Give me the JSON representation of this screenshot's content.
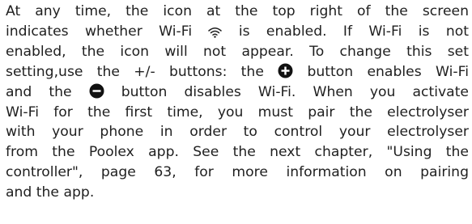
{
  "document": {
    "line1": "At any time, the icon at the top right of the screen",
    "line2_pre": "indicates whether Wi-Fi",
    "line2_post": "is enabled. If Wi-Fi is not",
    "line3": "enabled, the icon will not appear. To change this set",
    "line4_pre": "setting,use the +/- buttons: the",
    "line4_post": "button enables Wi-Fi",
    "line5_pre": "and the",
    "line5_post": "button disables Wi-Fi. When you activate",
    "line6": "Wi-Fi for the first time, you must pair the electrolyser",
    "line7": "with your phone in order to control your electrolyser",
    "line8": "from the Poolex app. See the next chapter, \"Using the",
    "line9": "controller\", page 63, for more information on pairing",
    "line10": "and the app."
  },
  "icons": {
    "wifi": "wifi-icon",
    "plus": "plus-button-icon",
    "minus": "minus-button-icon"
  }
}
